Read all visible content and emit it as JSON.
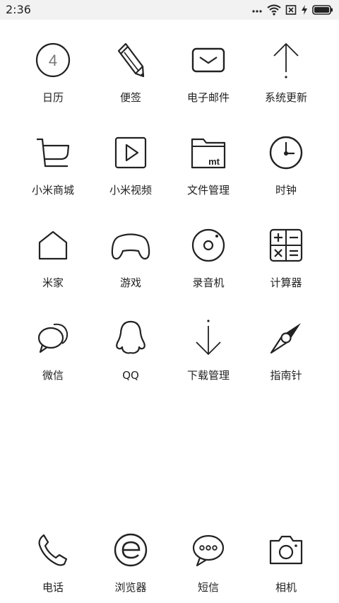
{
  "status_bar": {
    "time": "2:36",
    "icons": [
      "more-dots-icon",
      "wifi-icon",
      "sim-none-icon",
      "charging-bolt-icon",
      "battery-icon"
    ]
  },
  "calendar_day": "4",
  "apps": [
    {
      "label": "日历",
      "icon": "calendar-icon"
    },
    {
      "label": "便签",
      "icon": "pencil-icon"
    },
    {
      "label": "电子邮件",
      "icon": "envelope-icon"
    },
    {
      "label": "系统更新",
      "icon": "arrow-up-icon"
    },
    {
      "label": "小米商城",
      "icon": "shopping-cart-icon"
    },
    {
      "label": "小米视频",
      "icon": "video-play-icon"
    },
    {
      "label": "文件管理",
      "icon": "folder-icon"
    },
    {
      "label": "时钟",
      "icon": "clock-icon"
    },
    {
      "label": "米家",
      "icon": "house-icon"
    },
    {
      "label": "游戏",
      "icon": "gamepad-icon"
    },
    {
      "label": "录音机",
      "icon": "recorder-icon"
    },
    {
      "label": "计算器",
      "icon": "calculator-icon"
    },
    {
      "label": "微信",
      "icon": "wechat-icon"
    },
    {
      "label": "QQ",
      "icon": "qq-penguin-icon"
    },
    {
      "label": "下载管理",
      "icon": "arrow-down-icon"
    },
    {
      "label": "指南针",
      "icon": "compass-icon"
    }
  ],
  "dock": [
    {
      "label": "电话",
      "icon": "phone-icon"
    },
    {
      "label": "浏览器",
      "icon": "browser-icon"
    },
    {
      "label": "短信",
      "icon": "message-bubble-icon"
    },
    {
      "label": "相机",
      "icon": "camera-icon"
    }
  ],
  "folder_badge": "mt"
}
